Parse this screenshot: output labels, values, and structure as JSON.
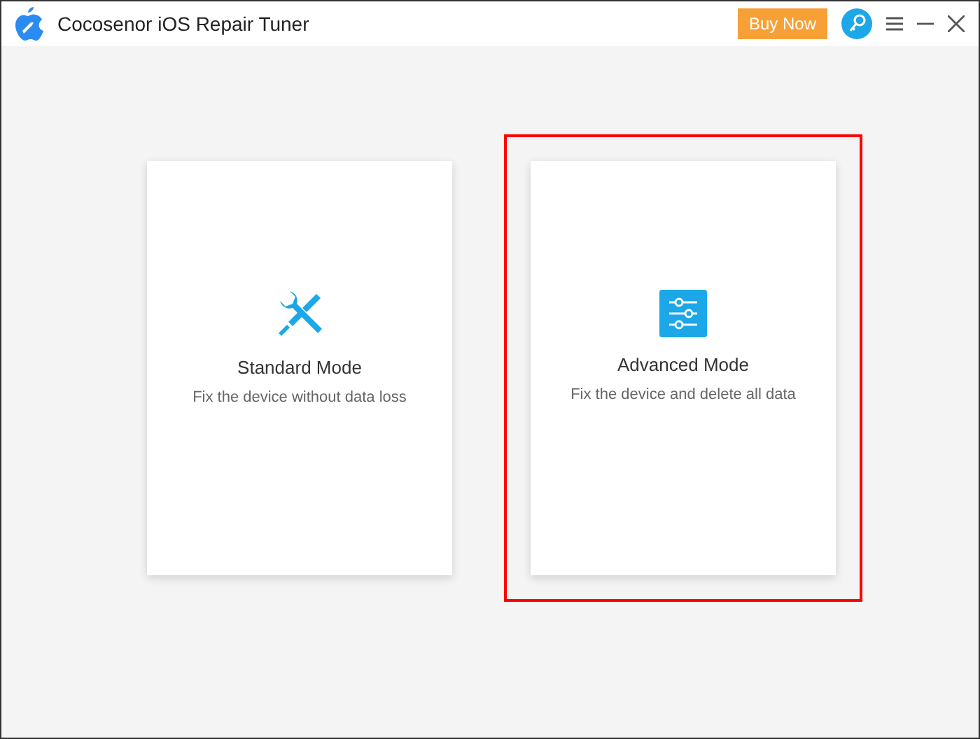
{
  "window": {
    "title": "Cocosenor iOS Repair Tuner",
    "buy_button": "Buy Now"
  },
  "modes": [
    {
      "kind": "tools",
      "title": "Standard Mode",
      "description": "Fix the device without data loss",
      "highlighted": false
    },
    {
      "kind": "sliders",
      "title": "Advanced Mode",
      "description": "Fix the device and delete all data",
      "highlighted": true
    }
  ]
}
